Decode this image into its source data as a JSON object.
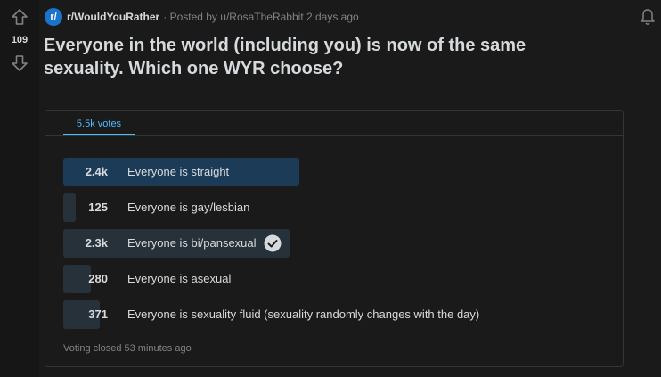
{
  "vote": {
    "score": "109"
  },
  "meta": {
    "subreddit_icon": "r/",
    "subreddit": "r/WouldYouRather",
    "posted": "· Posted by u/RosaTheRabbit 2 days ago"
  },
  "post": {
    "title": "Everyone in the world (including you) is now of the same sexuality. Which one WYR choose?"
  },
  "poll": {
    "total_votes": "5.5k votes",
    "options": [
      {
        "count": "2.4k",
        "label": "Everyone is straight",
        "votes": 2400,
        "winner": true,
        "selected": false
      },
      {
        "count": "125",
        "label": "Everyone is gay/lesbian",
        "votes": 125,
        "winner": false,
        "selected": false
      },
      {
        "count": "2.3k",
        "label": "Everyone is bi/pansexual",
        "votes": 2300,
        "winner": false,
        "selected": true
      },
      {
        "count": "280",
        "label": "Everyone is asexual",
        "votes": 280,
        "winner": false,
        "selected": false
      },
      {
        "count": "371",
        "label": "Everyone is sexuality fluid (sexuality randomly changes with the day)",
        "votes": 371,
        "winner": false,
        "selected": false
      }
    ],
    "status": "Voting closed 53 minutes ago"
  },
  "colors": {
    "background": "#1a1a1b",
    "accent": "#4fbcff",
    "winner_bar": "#1c3b57",
    "bar": "#27313a"
  },
  "icons": [
    "upvote-arrow-icon",
    "downvote-arrow-icon",
    "subreddit-icon",
    "bell-icon",
    "checkmark-icon"
  ]
}
